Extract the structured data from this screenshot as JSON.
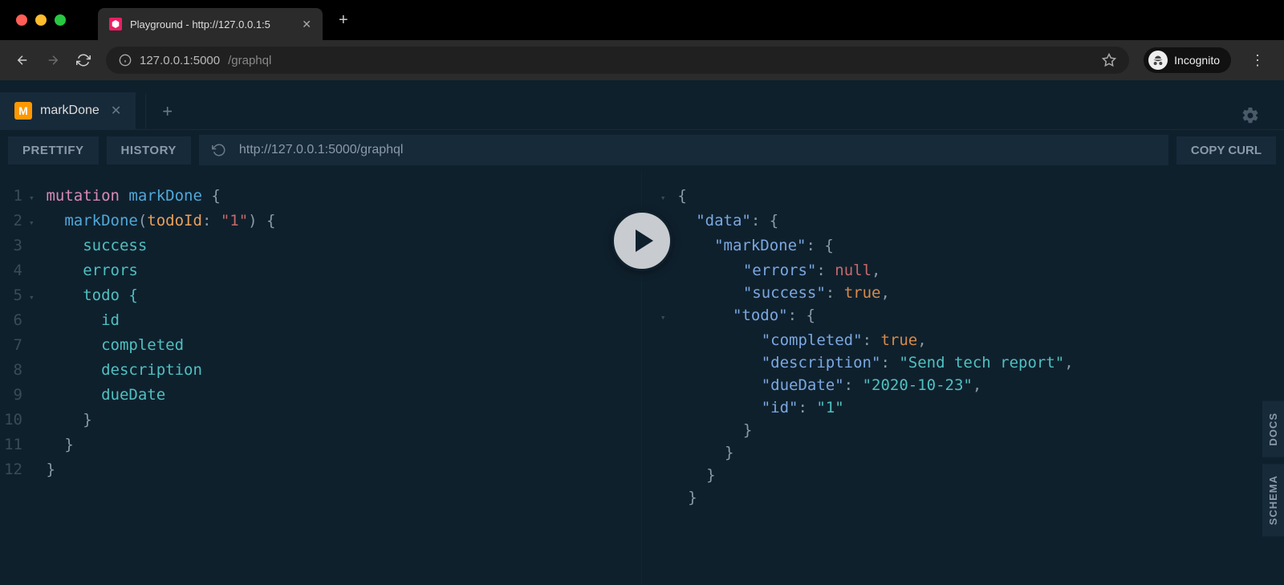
{
  "browser": {
    "tabTitle": "Playground - http://127.0.0.1:5",
    "url_host": "127.0.0.1:5000",
    "url_path": "/graphql",
    "incognito": "Incognito"
  },
  "playground": {
    "tabBadge": "M",
    "tabName": "markDone",
    "prettify": "PRETTIFY",
    "history": "HISTORY",
    "endpoint": "http://127.0.0.1:5000/graphql",
    "copyCurl": "COPY CURL",
    "docs": "DOCS",
    "schema": "SCHEMA"
  },
  "query": {
    "l1": {
      "kw": "mutation",
      "name": "markDone",
      "punc": " {"
    },
    "l2": {
      "name": "markDone",
      "arg": "todoId",
      "val": "\"1\""
    },
    "l3": "success",
    "l4": "errors",
    "l5": "todo {",
    "l6": "id",
    "l7": "completed",
    "l8": "description",
    "l9": "dueDate",
    "l10": "}",
    "l11": "}",
    "l12": "}"
  },
  "response": {
    "data": "\"data\"",
    "markDone": "\"markDone\"",
    "errors_k": "\"errors\"",
    "errors_v": "null",
    "success_k": "\"success\"",
    "success_v": "true",
    "todo_k": "\"todo\"",
    "completed_k": "\"completed\"",
    "completed_v": "true",
    "description_k": "\"description\"",
    "description_v": "\"Send tech report\"",
    "dueDate_k": "\"dueDate\"",
    "dueDate_v": "\"2020-10-23\"",
    "id_k": "\"id\"",
    "id_v": "\"1\""
  }
}
